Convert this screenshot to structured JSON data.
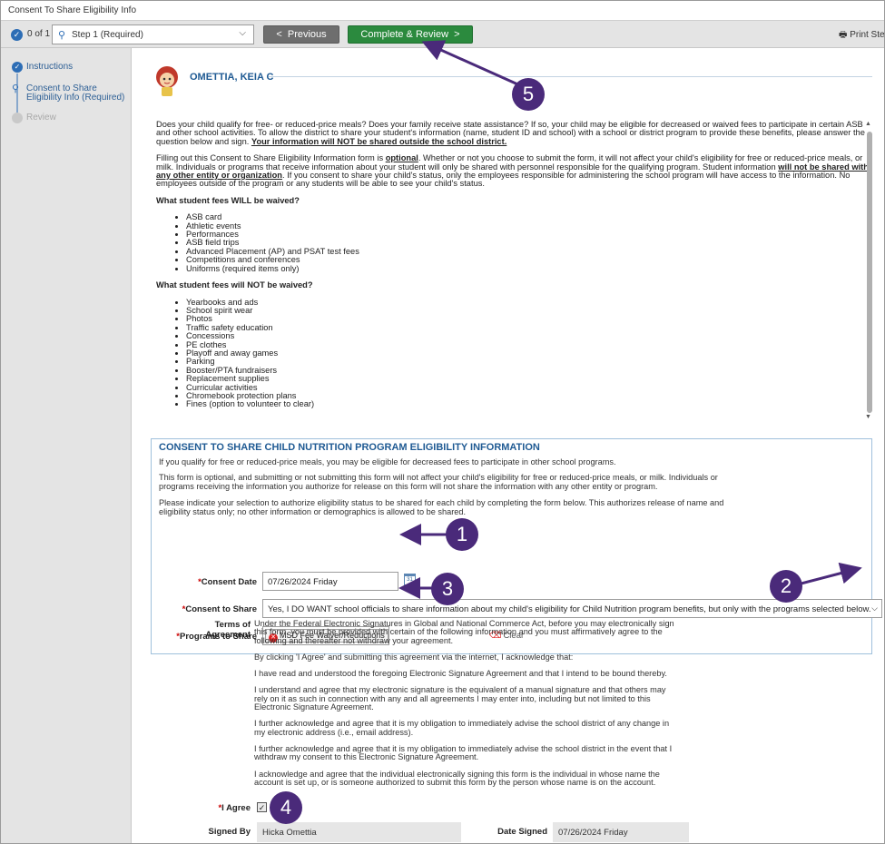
{
  "window": {
    "title": "Consent To Share Eligibility Info"
  },
  "toolbar": {
    "step_count": "0 of 1",
    "step_select": "Step 1 (Required)",
    "previous_label": "Previous",
    "complete_label": "Complete & Review",
    "print_label": "Print Ste"
  },
  "sidebar": {
    "items": [
      {
        "label": "Instructions"
      },
      {
        "label": "Consent to Share Eligibility Info (Required)"
      },
      {
        "label": "Review"
      }
    ]
  },
  "student": {
    "name": "OMETTIA, KEIA C"
  },
  "info": {
    "p1_a": "Does your child qualify for free- or reduced-price meals? Does your family receive state assistance? If so, your child may be eligible for decreased or waived fees to participate in certain ASB and other school activities. To allow the district to share your student's information (name, student ID and school) with a school or district program to provide these benefits, please answer the question below and sign.",
    "p1_b": "Your information will NOT be shared outside the school district.",
    "p2_a": "Filling out this Consent to Share Eligibility Information form is",
    "p2_b": "optional",
    "p2_c": ". Whether or not you choose to submit the form, it will not affect your child's eligibility for free or reduced-price meals, or milk. Individuals or programs that receive information about your student will only be shared with personnel responsible for the qualifying program. Student information",
    "p2_d": "will not be shared with any other entity or organization",
    "p2_e": ". If you consent to share your child's status, only the employees responsible for administering the school program will have access to the information. No employees outside of the program or any students will be able to see your child's status.",
    "waived_heading": "What student fees WILL be waived?",
    "waived": [
      "ASB card",
      "Athletic events",
      "Performances",
      "ASB field trips",
      "Advanced Placement (AP) and PSAT test fees",
      "Competitions and conferences",
      "Uniforms (required items only)"
    ],
    "not_waived_heading": "What student fees will NOT be waived?",
    "not_waived": [
      "Yearbooks and ads",
      "School spirit wear",
      "Photos",
      "Traffic safety education",
      "Concessions",
      "PE clothes",
      "Playoff and away games",
      "Parking",
      "Booster/PTA fundraisers",
      "Replacement supplies",
      "Curricular activities",
      "Chromebook protection plans",
      "Fines (option to volunteer to clear)"
    ]
  },
  "consent": {
    "title": "CONSENT TO SHARE CHILD NUTRITION PROGRAM ELIGIBILITY INFORMATION",
    "text1": "If you qualify for free or reduced-price meals, you may be eligible for decreased fees to participate in other school programs.",
    "text2": "This form is optional, and submitting or not submitting this form will not affect your child's eligibility for free or reduced-price meals, or milk. Individuals or programs receiving the information you authorize for release on this form will not share the information with any other entity or program.",
    "text3": "Please indicate your selection to authorize eligibility status to be shared for each child by completing the form below. This authorizes release of name and eligibility status only; no other information or demographics is allowed to be shared.",
    "date_label": "Consent Date",
    "date_value": "07/26/2024 Friday",
    "share_label": "Consent to Share",
    "share_value": "Yes, I DO WANT school officials to share information about my child's eligibility for Child Nutrition program benefits, but only with the programs selected below.",
    "programs_label": "Programs to Share",
    "program_tag": "MSD Fee Waiver/Reductions",
    "clear_label": "Clear"
  },
  "terms": {
    "label": "Terms of Agreement",
    "paragraphs": [
      "Under the Federal Electronic Signatures in Global and National Commerce Act, before you may electronically sign this form, you must be provided with certain of the following information and you must affirmatively agree to the following and thereafter not withdraw your agreement.",
      "By clicking 'I Agree' and submitting this agreement via the internet, I acknowledge that:",
      "I have read and understood the foregoing Electronic Signature Agreement and that I intend to be bound thereby.",
      "I understand and agree that my electronic signature is the equivalent of a manual signature and that others may rely on it as such in connection with any and all agreements I may enter into, including but not limited to this Electronic Signature Agreement.",
      "I further acknowledge and agree that it is my obligation to immediately advise the school district of any change in my electronic address (i.e., email address).",
      "I further acknowledge and agree that it is my obligation to immediately advise the school district in the event that I withdraw my consent to this Electronic Signature Agreement.",
      "I acknowledge and agree that the individual electronically signing this form is the individual in whose name the account is set up, or is someone authorized to submit this form by the person whose name is on the account."
    ]
  },
  "signature": {
    "agree_label": "I Agree",
    "signed_by_label": "Signed By",
    "signed_by_value": "Hicka Omettia",
    "date_signed_label": "Date Signed",
    "date_signed_value": "07/26/2024 Friday"
  },
  "callouts": [
    "1",
    "2",
    "3",
    "4",
    "5"
  ],
  "colors": {
    "accent": "#2d6db5",
    "complete": "#2b8a3e",
    "callout": "#4a2a7a",
    "heading": "#1f5a93"
  }
}
